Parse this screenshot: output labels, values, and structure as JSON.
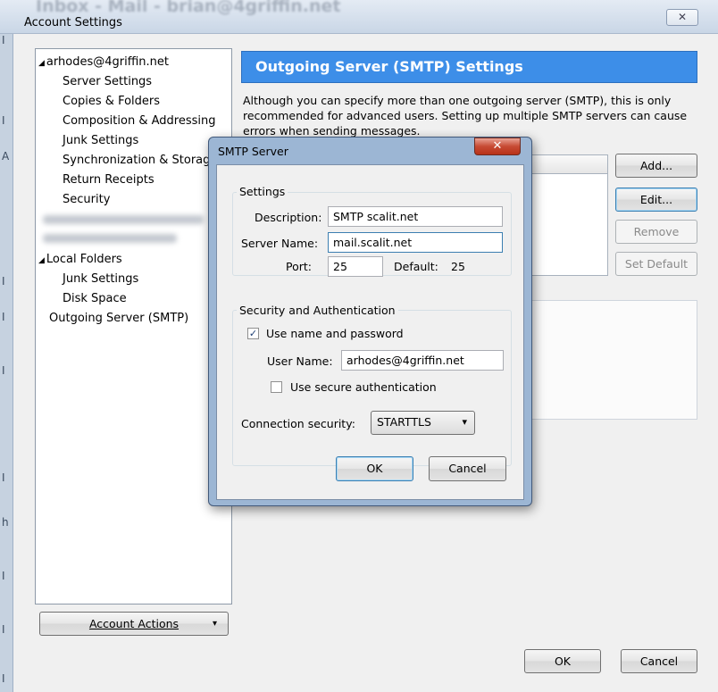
{
  "window": {
    "background_title": "Inbox - Mail - brian@4griffin.net",
    "title": "Account Settings",
    "close_glyph": "✕"
  },
  "left_strip_chars": [
    "I",
    "I",
    "A",
    "I",
    "I",
    "I",
    "I",
    "h",
    "I",
    "I",
    "I"
  ],
  "tree": {
    "items": [
      {
        "label": "arhodes@4griffin.net",
        "twisty": "◢"
      },
      {
        "label": "Server Settings"
      },
      {
        "label": "Copies & Folders"
      },
      {
        "label": "Composition & Addressing"
      },
      {
        "label": "Junk Settings"
      },
      {
        "label": "Synchronization & Storage"
      },
      {
        "label": "Return Receipts"
      },
      {
        "label": "Security"
      },
      {
        "label": "Local Folders",
        "twisty": "◢"
      },
      {
        "label": "Junk Settings"
      },
      {
        "label": "Disk Space"
      },
      {
        "label": "Outgoing Server (SMTP)"
      }
    ]
  },
  "account_actions": {
    "label": "Account Actions",
    "arrow": "▾"
  },
  "main": {
    "header": "Outgoing Server (SMTP) Settings",
    "description": "Although you can specify more than one outgoing server (SMTP), this is only recommended for advanced users. Setting up multiple SMTP servers can cause errors when sending messages.",
    "buttons": {
      "add": "Add...",
      "edit": "Edit...",
      "remove": "Remove",
      "set_default": "Set Default"
    }
  },
  "footer": {
    "ok": "OK",
    "cancel": "Cancel"
  },
  "smtp_dialog": {
    "title": "SMTP Server",
    "close_glyph": "✕",
    "settings_legend": "Settings",
    "description_label": "Description:",
    "description_value": "SMTP scalit.net",
    "server_name_label": "Server Name:",
    "server_name_value": "mail.scalit.net",
    "port_label": "Port:",
    "port_value": "25",
    "default_label": "Default:",
    "default_value": "25",
    "security_legend": "Security and Authentication",
    "use_name_password_label": "Use name and password",
    "use_name_password_checked": "✓",
    "user_name_label": "User Name:",
    "user_name_value": "arhodes@4griffin.net",
    "secure_auth_label": "Use secure authentication",
    "connection_security_label": "Connection security:",
    "connection_security_value": "STARTTLS",
    "select_arrow": "▾",
    "ok": "OK",
    "cancel": "Cancel"
  }
}
